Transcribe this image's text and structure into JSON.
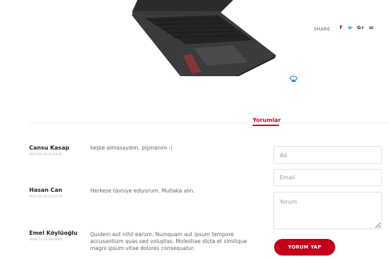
{
  "share": {
    "label": "SHARE",
    "icons": [
      "facebook-icon",
      "twitter-icon",
      "google-plus-icon",
      "email-icon"
    ],
    "glyphs": {
      "facebook": "f",
      "twitter": "🐦",
      "google_plus": "G+",
      "email": "✉"
    }
  },
  "tabs": {
    "active": "Yorumlar"
  },
  "comments": [
    {
      "name": "Cansu Kasap",
      "date": "2021-05-16 21:44:42",
      "text": "keşke almasaydım. pişmanım :("
    },
    {
      "name": "Hasan Can",
      "date": "2021-05-16 21:44:15",
      "text": "Herkese tavsiye ediyorum. Mutlaka alın."
    },
    {
      "name": "Emel Köylüoğlu",
      "date": "2009-11-23 00:00:00",
      "text": "Quidem aut nihil earum. Numquam aut ipsum tempore accusantium quas sed voluptas. Molestiae dicta et similique magni ipsum vitae dolores consequatur."
    }
  ],
  "form": {
    "name_placeholder": "Ad",
    "email_placeholder": "Email",
    "comment_placeholder": "Yorum",
    "submit_label": "YORUM YAP"
  },
  "colors": {
    "accent": "#c4001b",
    "tab_accent": "#d0021b"
  }
}
